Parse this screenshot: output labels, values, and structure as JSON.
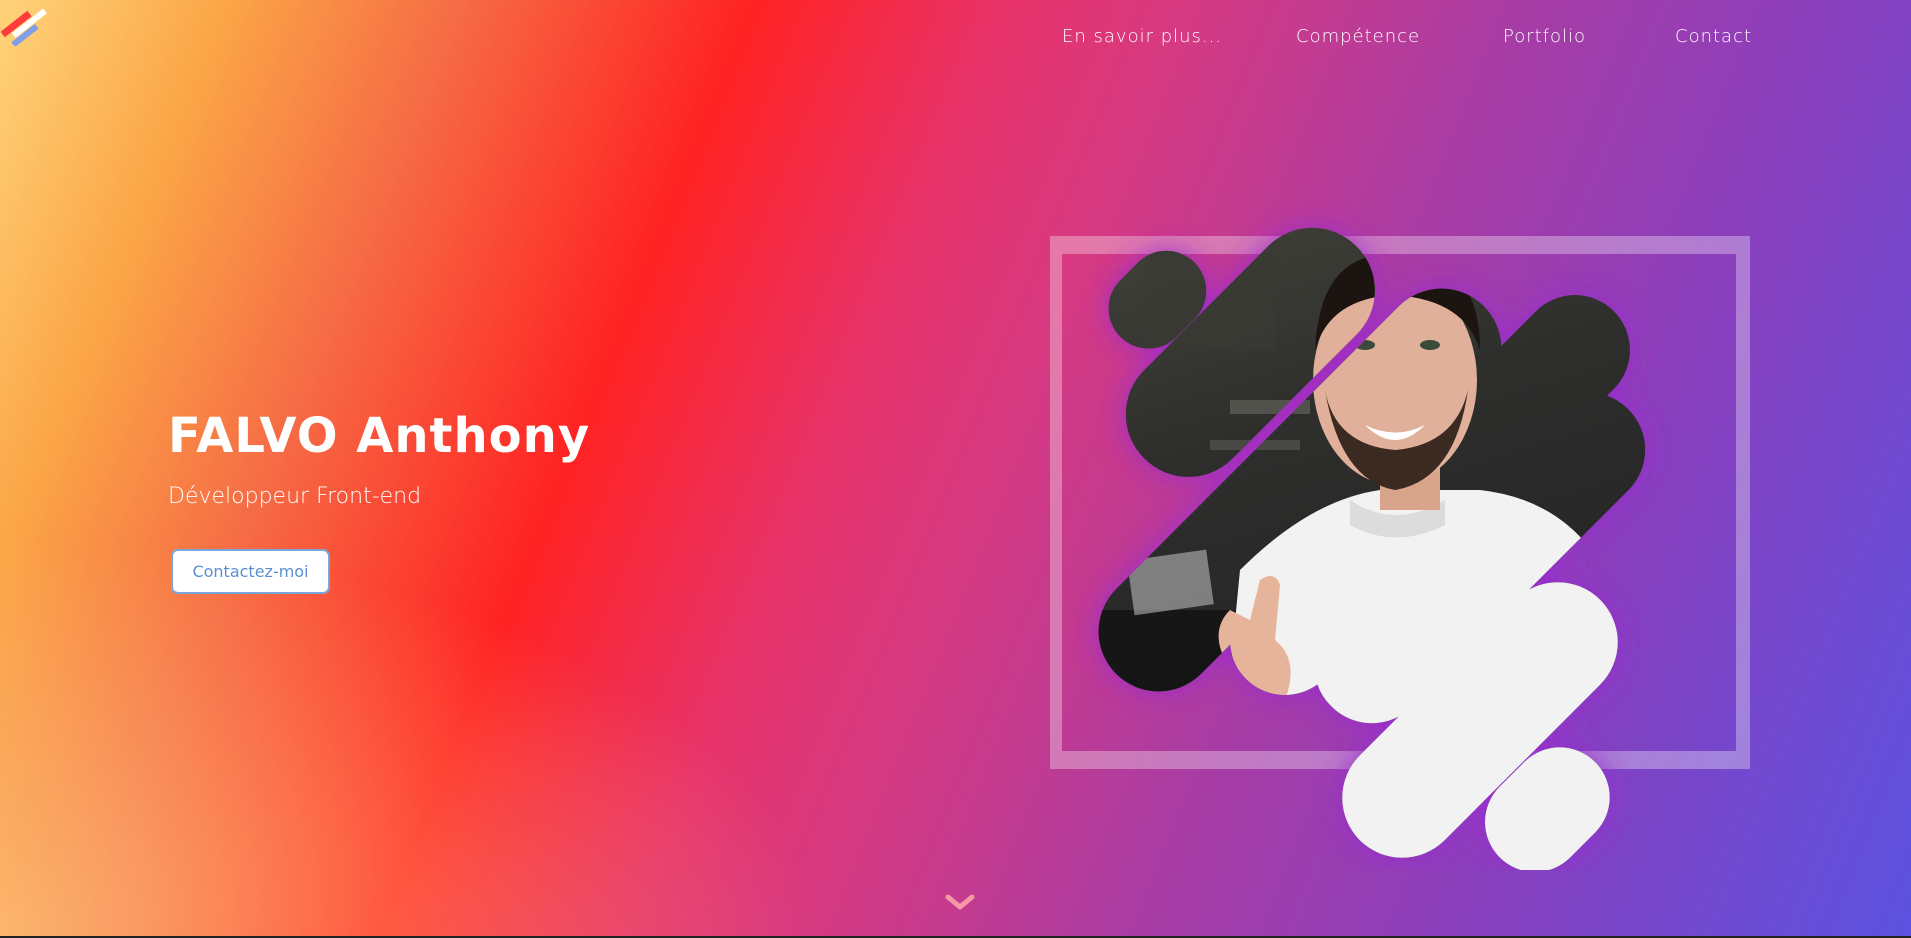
{
  "app": {
    "logo_icon": "stripes-logo-icon"
  },
  "nav": {
    "items": [
      {
        "label": "En savoir plus..."
      },
      {
        "label": "Compétence"
      },
      {
        "label": "Portfolio"
      },
      {
        "label": "Contact"
      }
    ]
  },
  "hero": {
    "name": "FALVO Anthony",
    "role": "Développeur Front-end",
    "cta_label": "Contactez-moi",
    "portrait_icon": "portrait-photo",
    "scroll_icon": "chevron-down-icon"
  },
  "colors": {
    "gradient": [
      "#ffd37a",
      "#fba546",
      "#f66c45",
      "#ff2222",
      "#e8336a",
      "#d63a82",
      "#a93ca4",
      "#8a3fbd",
      "#5b52e0"
    ],
    "cta_text": "#5b8fd0",
    "cta_border": "#7aa6dc",
    "glow": "#9a2bd0"
  }
}
